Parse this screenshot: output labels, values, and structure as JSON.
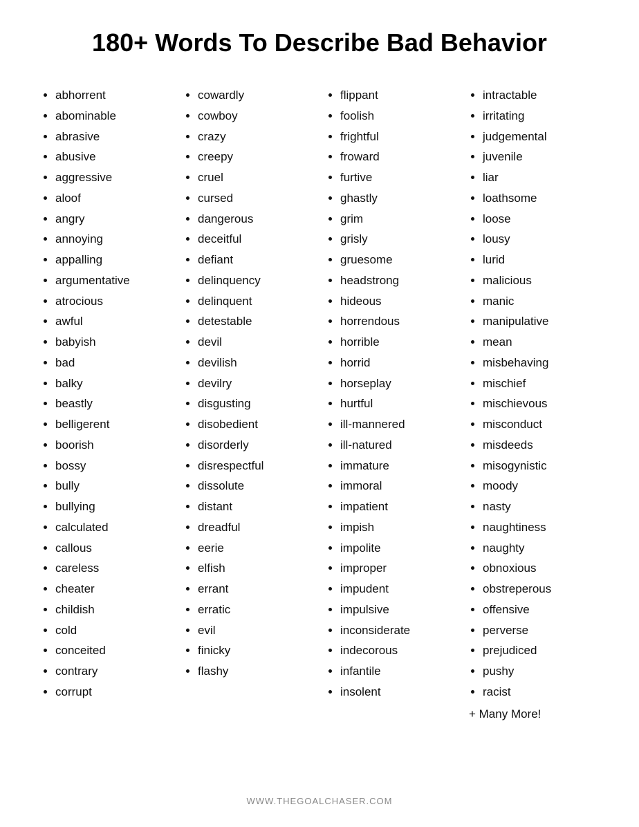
{
  "title": "180+ Words To Describe Bad Behavior",
  "columns": [
    {
      "id": "col1",
      "items": [
        "abhorrent",
        "abominable",
        "abrasive",
        "abusive",
        "aggressive",
        "aloof",
        "angry",
        "annoying",
        "appalling",
        "argumentative",
        "atrocious",
        "awful",
        "babyish",
        "bad",
        "balky",
        "beastly",
        "belligerent",
        "boorish",
        "bossy",
        "bully",
        "bullying",
        "calculated",
        "callous",
        "careless",
        "cheater",
        "childish",
        "cold",
        "conceited",
        "contrary",
        "corrupt"
      ]
    },
    {
      "id": "col2",
      "items": [
        "cowardly",
        "cowboy",
        "crazy",
        "creepy",
        "cruel",
        "cursed",
        "dangerous",
        "deceitful",
        "defiant",
        "delinquency",
        "delinquent",
        "detestable",
        "devil",
        "devilish",
        "devilry",
        "disgusting",
        "disobedient",
        "disorderly",
        "disrespectful",
        "dissolute",
        "distant",
        "dreadful",
        "eerie",
        "elfish",
        "errant",
        "erratic",
        "evil",
        "finicky",
        "flashy"
      ]
    },
    {
      "id": "col3",
      "items": [
        "flippant",
        "foolish",
        "frightful",
        "froward",
        "furtive",
        "ghastly",
        "grim",
        "grisly",
        "gruesome",
        "headstrong",
        "hideous",
        "horrendous",
        "horrible",
        "horrid",
        "horseplay",
        "hurtful",
        "ill-mannered",
        "ill-natured",
        "immature",
        "immoral",
        "impatient",
        "impish",
        "impolite",
        "improper",
        "impudent",
        "impulsive",
        "inconsiderate",
        "indecorous",
        "infantile",
        "insolent"
      ]
    },
    {
      "id": "col4",
      "items": [
        "intractable",
        "irritating",
        "judgemental",
        "juvenile",
        "liar",
        "loathsome",
        "loose",
        "lousy",
        "lurid",
        "malicious",
        "manic",
        "manipulative",
        "mean",
        "misbehaving",
        "mischief",
        "mischievous",
        "misconduct",
        "misdeeds",
        "misogynistic",
        "moody",
        "nasty",
        "naughtiness",
        "naughty",
        "obnoxious",
        "obstreperous",
        "offensive",
        "perverse",
        "prejudiced",
        "pushy",
        "racist"
      ],
      "extra": "+ Many More!"
    }
  ],
  "footer": "WWW.THEGOALCHASER.COM"
}
